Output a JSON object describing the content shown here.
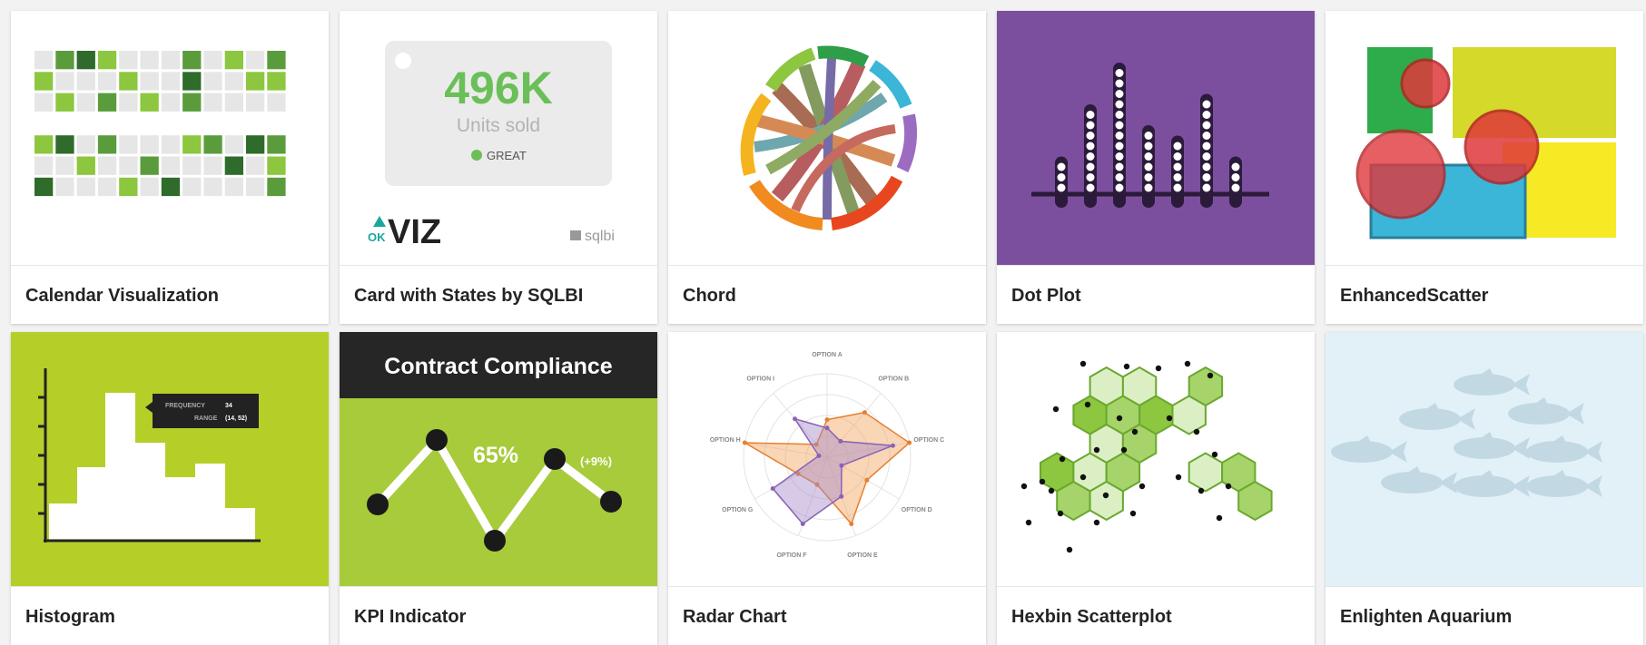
{
  "gallery": {
    "cards": [
      {
        "label": "Calendar Visualization",
        "accent": "#5a9c3c"
      },
      {
        "label": "Card with States by SQLBI",
        "accent": "#6bbf59",
        "kpi": {
          "value": "496K",
          "caption": "Units sold",
          "state": "GREAT"
        },
        "brand": {
          "prefix": "OK",
          "name": "VIZ",
          "vendor": "sqlbi"
        }
      },
      {
        "label": "Chord",
        "accent": "#e8461e"
      },
      {
        "label": "Dot Plot",
        "accent": "#7b4f9e"
      },
      {
        "label": "EnhancedScatter",
        "accent": "#d4d92a"
      },
      {
        "label": "Histogram",
        "accent": "#b5cf28",
        "tooltip": {
          "frequency_label": "FREQUENCY",
          "frequency_value": "34",
          "range_label": "RANGE",
          "range_value": "(14, 52)"
        }
      },
      {
        "label": "KPI Indicator",
        "accent": "#a7cb3a",
        "kpi": {
          "title": "Contract Compliance",
          "value": "65%",
          "delta": "(+9%)"
        }
      },
      {
        "label": "Radar Chart",
        "accent": "#e87e2e",
        "axes": [
          "OPTION A",
          "OPTION B",
          "OPTION C",
          "OPTION D",
          "OPTION E",
          "OPTION F",
          "OPTION G",
          "OPTION H",
          "OPTION I"
        ]
      },
      {
        "label": "Hexbin Scatterplot",
        "accent": "#8dc63f"
      },
      {
        "label": "Enlighten Aquarium",
        "accent": "#cfe6f2"
      }
    ]
  }
}
